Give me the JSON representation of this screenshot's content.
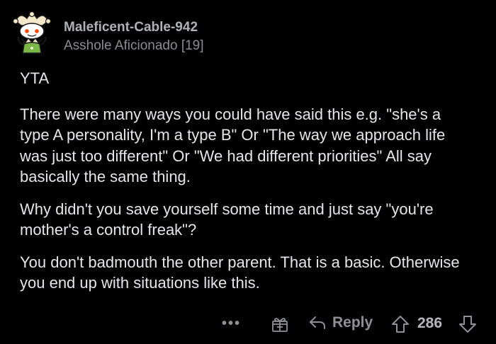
{
  "comment": {
    "username": "Maleficent-Cable-942",
    "flair": "Asshole Aficionado [19]",
    "paragraphs": [
      "YTA",
      "There were many ways you could have said this e.g. \"she's a type A personality, I'm a type B\" Or \"The way we approach life was just too different\" Or \"We had different priorities\" All say basically the same thing.",
      "Why didn't you save yourself some time and just say \"you're mother's a control freak\"?",
      "You don't badmouth the other parent. That is a basic. Otherwise you end up with situations like this."
    ]
  },
  "actions": {
    "more_label": "•••",
    "reply_label": "Reply",
    "score": "286"
  },
  "icons": {
    "avatar": "snoo-jester-avatar-icon",
    "more": "more-options-icon",
    "gift": "gift-award-icon",
    "reply": "reply-arrow-icon",
    "upvote": "upvote-arrow-icon",
    "downvote": "downvote-arrow-icon"
  },
  "colors": {
    "background": "#000000",
    "text": "#e4e6e8",
    "muted": "#8e9194",
    "avatar_green": "#7ab648"
  }
}
